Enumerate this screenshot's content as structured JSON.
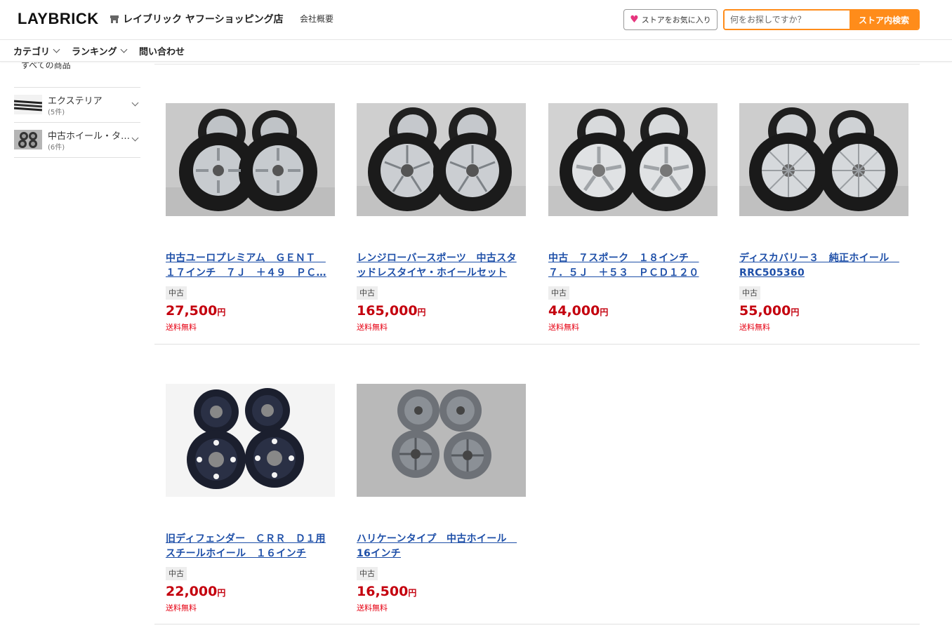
{
  "header": {
    "logo": "LAYBRICK",
    "store_name": "レイブリック ヤフーショッピング店",
    "company_link": "会社概要",
    "favorite_label": "ストアをお気に入り",
    "search_placeholder": "何をお探しですか？",
    "search_button": "ストア内検索"
  },
  "nav": {
    "items": [
      {
        "label": "カテゴリ",
        "has_dropdown": true
      },
      {
        "label": "ランキング",
        "has_dropdown": true
      },
      {
        "label": "問い合わせ",
        "has_dropdown": false
      }
    ]
  },
  "sidebar": {
    "all_products": "すべての商品",
    "categories": [
      {
        "label": "エクステリア",
        "count": "(5件)"
      },
      {
        "label": "中古ホイール・タ…",
        "count": "(6件)"
      }
    ]
  },
  "products": [
    {
      "title": "中古ユーロプレミアム　ＧＥＮＴ　１７インチ　７Ｊ　＋４９　ＰＣ…",
      "condition": "中古",
      "price": "27,500",
      "currency": "円",
      "shipping": "送料無料"
    },
    {
      "title": "レンジローバースポーツ　中古スタッドレスタイヤ・ホイールセット",
      "condition": "中古",
      "price": "165,000",
      "currency": "円",
      "shipping": "送料無料"
    },
    {
      "title": "中古　７スポーク　１８インチ　７．５Ｊ　＋５３　ＰＣＤ１２０",
      "condition": "中古",
      "price": "44,000",
      "currency": "円",
      "shipping": "送料無料"
    },
    {
      "title": "ディスカバリー３　純正ホイール　RRC505360",
      "condition": "中古",
      "price": "55,000",
      "currency": "円",
      "shipping": "送料無料"
    },
    {
      "title": "旧ディフェンダー　ＣＲＲ　Ｄ１用スチールホイール　１６インチ",
      "condition": "中古",
      "price": "22,000",
      "currency": "円",
      "shipping": "送料無料"
    },
    {
      "title": "ハリケーンタイプ　中古ホイール　16インチ",
      "condition": "中古",
      "price": "16,500",
      "currency": "円",
      "shipping": "送料無料"
    }
  ],
  "colors": {
    "accent": "#ff8c1a",
    "price": "#c4000e",
    "link": "#1e4fa8",
    "shipping": "#e60012"
  }
}
